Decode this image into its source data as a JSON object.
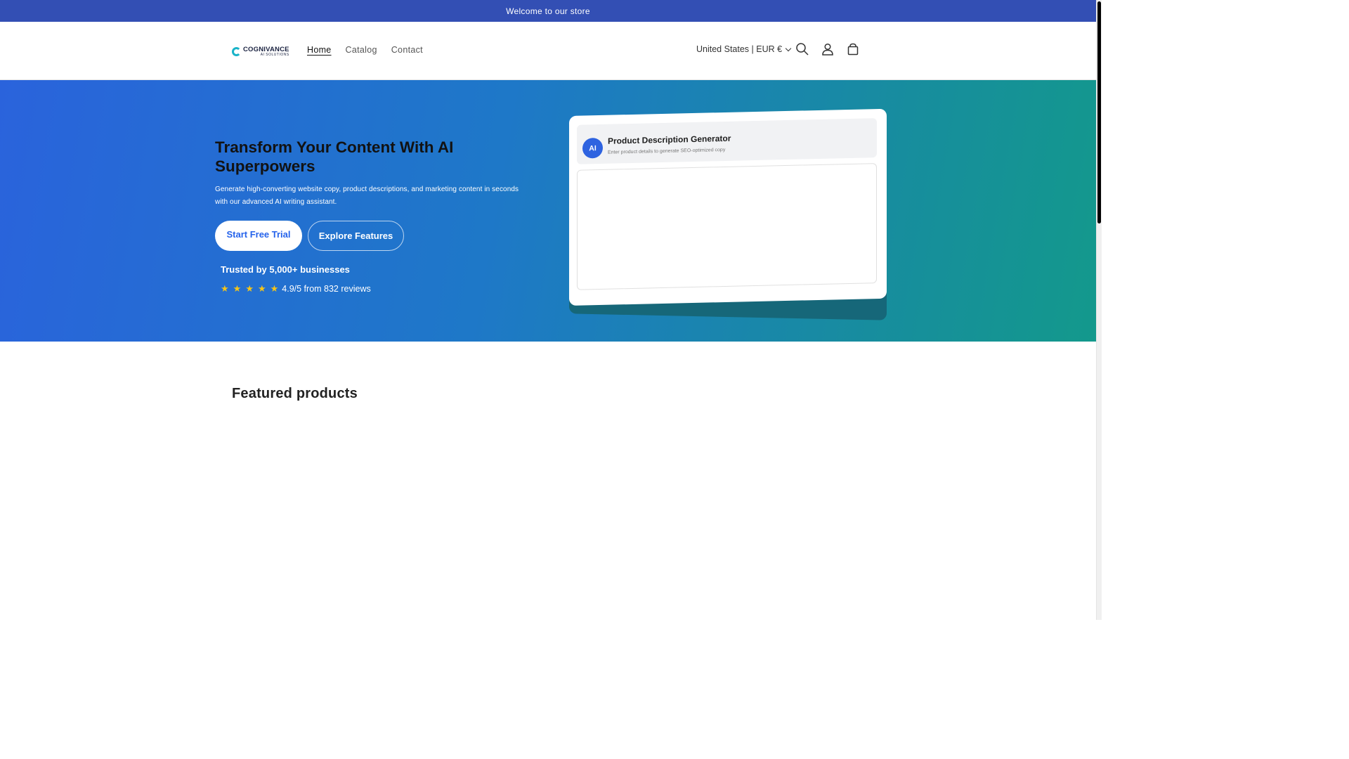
{
  "announcement": {
    "text": "Welcome to our store"
  },
  "header": {
    "logo": {
      "name": "COGNIVANCE",
      "tagline": "AI SOLUTIONS"
    },
    "nav": [
      {
        "label": "Home",
        "active": true
      },
      {
        "label": "Catalog",
        "active": false
      },
      {
        "label": "Contact",
        "active": false
      }
    ],
    "locale": "United States | EUR €",
    "icons": [
      "search-icon",
      "account-icon",
      "cart-icon"
    ]
  },
  "hero": {
    "title": "Transform Your Content With AI Superpowers",
    "description": "Generate high-converting website copy, product descriptions, and marketing content in seconds with our advanced AI writing assistant.",
    "primary_button": "Start Free Trial",
    "secondary_button": "Explore Features",
    "trusted": "Trusted by 5,000+ businesses",
    "stars": 5,
    "rating_text": "4.9/5 from 832 reviews",
    "gradient": [
      "#2a63dc",
      "#13998c"
    ]
  },
  "mockup": {
    "badge": "AI",
    "title": "Product Description Generator",
    "subtitle": "Enter product details to generate SEO-optimized copy"
  },
  "featured": {
    "heading": "Featured products"
  },
  "colors": {
    "announcement_bg": "#334fb4",
    "accent": "#2563eb",
    "star": "#f5c518"
  }
}
